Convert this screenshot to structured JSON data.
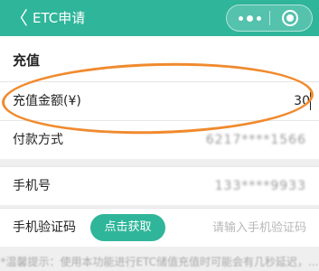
{
  "navbar": {
    "back_glyph": "〈",
    "title": "ETC申请"
  },
  "section": {
    "title": "充值"
  },
  "form": {
    "amount_label": "充值金额(¥)",
    "amount_value": "30",
    "payment_label": "付款方式",
    "payment_value": "6217****1566",
    "phone_label": "手机号",
    "phone_value": "133****9933",
    "code_label": "手机验证码",
    "code_button": "点击获取",
    "code_placeholder": "请输入手机验证码"
  },
  "tip": "*温馨提示：使用本功能进行ETC储值充值时可能会有几秒延迟，..."
}
